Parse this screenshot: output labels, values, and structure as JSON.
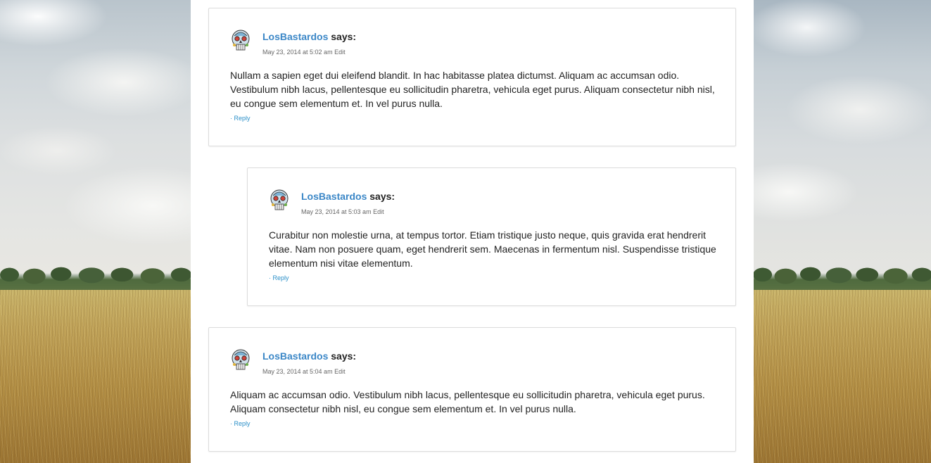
{
  "comments": [
    {
      "author": "LosBastardos",
      "says": "says:",
      "date": "May 23, 2014 at 5:02 am",
      "edit": "Edit",
      "text": "Nullam a sapien eget dui eleifend blandit. In hac habitasse platea dictumst. Aliquam ac accumsan odio. Vestibulum nibh lacus, pellentesque eu sollicitudin pharetra, vehicula eget purus. Aliquam consectetur nibh nisl, eu congue sem elementum et. In vel purus nulla.",
      "reply_prefix": "· ",
      "reply": "Reply"
    },
    {
      "author": "LosBastardos",
      "says": "says:",
      "date": "May 23, 2014 at 5:03 am",
      "edit": "Edit",
      "text": "Curabitur non molestie urna, at tempus tortor. Etiam tristique justo neque, quis gravida erat hendrerit vitae. Nam non posuere quam, eget hendrerit sem. Maecenas in fermentum nisl. Suspendisse tristique elementum nisi vitae elementum.",
      "reply_prefix": "· ",
      "reply": "Reply"
    },
    {
      "author": "LosBastardos",
      "says": "says:",
      "date": "May 23, 2014 at 5:04 am",
      "edit": "Edit",
      "text": "Aliquam ac accumsan odio. Vestibulum nibh lacus, pellentesque eu sollicitudin pharetra, vehicula eget purus. Aliquam consectetur nibh nisl, eu congue sem elementum et. In vel purus nulla.",
      "reply_prefix": "· ",
      "reply": "Reply"
    }
  ],
  "colors": {
    "author_link": "#3b87c7",
    "reply_link": "#2a8fc8",
    "card_border": "#dcdcdc"
  },
  "icons": {
    "avatar": "skull-avatar-icon"
  }
}
